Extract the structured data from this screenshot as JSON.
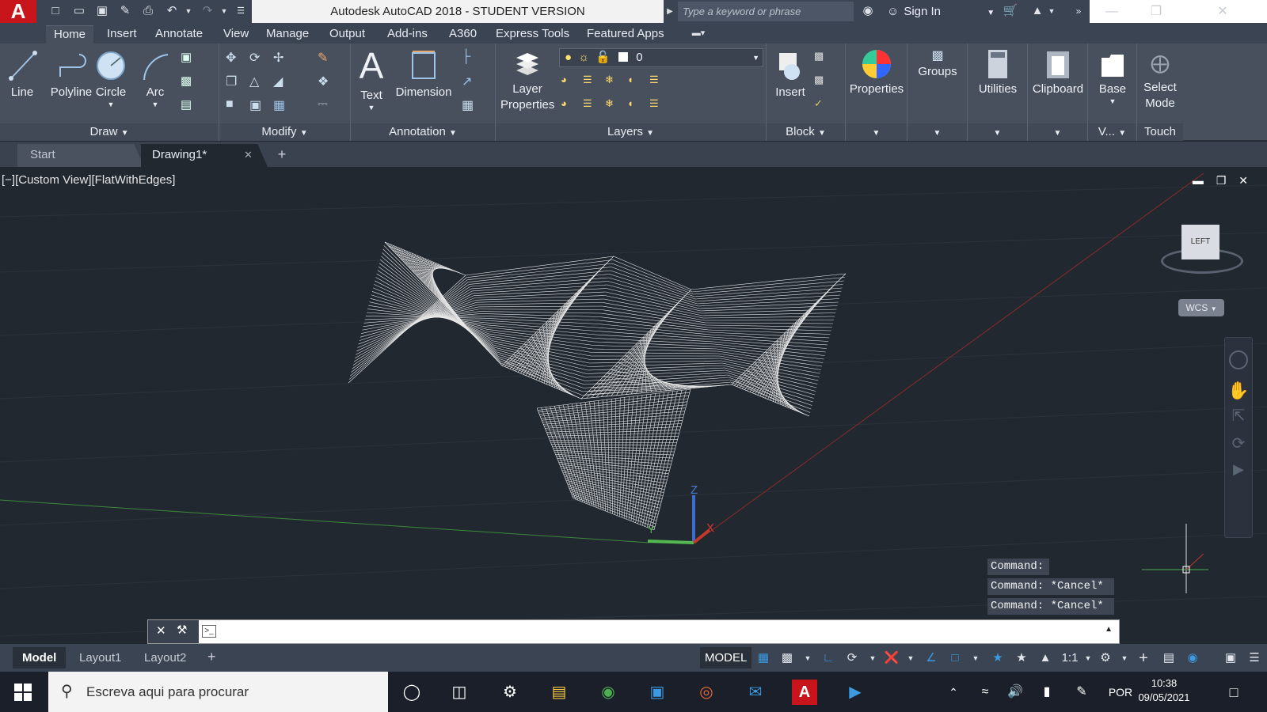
{
  "title_bar": {
    "app_logo": "A",
    "title": "Autodesk AutoCAD 2018 - STUDENT VERSION",
    "search_placeholder": "Type a keyword or phrase",
    "sign_in": "Sign In"
  },
  "ribbon_tabs": [
    "Home",
    "Insert",
    "Annotate",
    "View",
    "Manage",
    "Output",
    "Add-ins",
    "A360",
    "Express Tools",
    "Featured Apps"
  ],
  "ribbon": {
    "draw": {
      "title": "Draw",
      "line": "Line",
      "polyline": "Polyline",
      "circle": "Circle",
      "arc": "Arc"
    },
    "modify": {
      "title": "Modify"
    },
    "annotation": {
      "title": "Annotation",
      "text": "Text",
      "dimension": "Dimension"
    },
    "layers": {
      "title": "Layers",
      "layer_properties_1": "Layer",
      "layer_properties_2": "Properties",
      "current_layer": "0"
    },
    "block": {
      "title": "Block",
      "insert": "Insert"
    },
    "properties": "Properties",
    "groups": "Groups",
    "utilities": "Utilities",
    "clipboard": "Clipboard",
    "view": {
      "base": "Base",
      "short": "V..."
    },
    "touch": {
      "select_mode_1": "Select",
      "select_mode_2": "Mode",
      "title": "Touch"
    }
  },
  "file_tabs": {
    "start": "Start",
    "drawing": "Drawing1*"
  },
  "viewport": {
    "label": "[−][Custom View][FlatWithEdges]",
    "viewcube_face": "LEFT",
    "wcs": "WCS",
    "axis_z": "Z",
    "axis_y": "Y",
    "axis_x": "X"
  },
  "command_history": [
    "Command:",
    "Command: *Cancel*",
    "Command: *Cancel*"
  ],
  "command_input": "",
  "layout_tabs": [
    "Model",
    "Layout1",
    "Layout2"
  ],
  "status": {
    "model": "MODEL",
    "scale": "1:1"
  },
  "taskbar": {
    "search_placeholder": "Escreva aqui para procurar",
    "language": "POR",
    "time": "10:38",
    "date": "09/05/2021"
  }
}
